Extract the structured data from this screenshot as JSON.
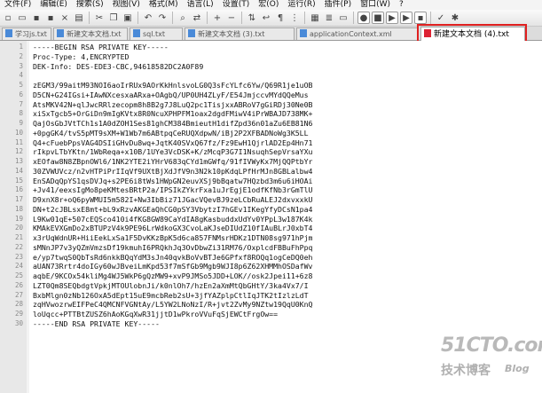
{
  "menu": [
    "文件(F)",
    "编辑(E)",
    "搜索(S)",
    "视图(V)",
    "格式(M)",
    "语言(L)",
    "设置(T)",
    "宏(O)",
    "运行(R)",
    "插件(P)",
    "窗口(W)",
    "?"
  ],
  "tabs": [
    {
      "label": "学习js.txt"
    },
    {
      "label": "新建文本文档.txt"
    },
    {
      "label": "sql.txt"
    },
    {
      "label": "新建文本文档 (3).txt"
    },
    {
      "label": "applicationContext.xml"
    },
    {
      "label": "新建文本文档 (4).txt",
      "active": true
    }
  ],
  "editor": {
    "lines": [
      {
        "n": "1",
        "text": "-----BEGIN RSA PRIVATE KEY-----"
      },
      {
        "n": "2",
        "text": "Proc-Type: 4,ENCRYPTED"
      },
      {
        "n": "3",
        "text": "DEK-Info: DES-EDE3-CBC,94618582DC2A0F89"
      },
      {
        "n": "4",
        "text": ""
      },
      {
        "n": "5",
        "text": "zEGM3/99aitM93NOI6aoIrRUx9AOrKkHnlsvoLG0Q3sFcYLfc6Yw/Q69R1je1uOB"
      },
      {
        "n": "6",
        "text": "D5CN+G24IGsi+IAwNXcesxaARxa+OAgbQ/UP0UH4ZLyF/E54JmjccvMYdQQeMus"
      },
      {
        "n": "7",
        "text": "AtsMKV42N+qlJwcRRlzecopm8h8B2g7J8LuQ2pc1TisjxxABRoV7gGiRDj30Ne0B"
      },
      {
        "n": "8",
        "text": "xiSxTgcb5+OrGiDn9mIgKVtx8R0NcuXPHPFM1oax2dgdFMiwV4iPrWBAJD738MK+"
      },
      {
        "n": "9",
        "text": "QajOsGbJVtTCh1s1A0dZOH1Ses81ghCM384BmieutH1difZpd36n01aZu6EB81N6"
      },
      {
        "n": "10",
        "text": "+0pgGK4/tvS5pMT9sXM+W1Wb7m6ABtpqCeRUQXdpwN/iBj2P2XFBADNoWg3K5LL"
      },
      {
        "n": "11",
        "text": "Q4+cFuebPpsVAG4DSIiGHvDu8wq+JqtK40SVxQ67fz/Fz9EwH1QjrlAD2Ep4Hn71"
      },
      {
        "n": "12",
        "text": "rIkpvLTbYKtn/1WbReqa+x10B/1UYe3VcDSK+K/zMcqP3G7I1NsuqhSepVrsaYXu"
      },
      {
        "n": "13",
        "text": "xEOfaw8N8ZBpnOWl6/1NK2YTE2iYHrV683qCYd1mGWfq/91fIVWyKx7MjQQPtbYr"
      },
      {
        "n": "14",
        "text": "30ZVWUVcz/n2vHTPiPrIIqVf9UXtBjXdJfV9n3N2k10pKdqLPfHrMJn8GBLalbw4"
      },
      {
        "n": "15",
        "text": "EnSADqQpYS1qsDVJq+s2PE6i8tWs1HWpGN2euvXSj9bBqatw7HQzbd3m6u6iHOAi"
      },
      {
        "n": "16",
        "text": "+Jv41/eexsIgMo8peKMtesBRtP2a/IPSIkZYkrFxa1uJrEgjE1odfKfNb3rGmTlU"
      },
      {
        "n": "17",
        "text": "D9xnX8r+oQ6pyWMUI5m582I+Nw3IbBiz71JGacVQevBJ9zeLCbRuALEJ2dxvxxkU"
      },
      {
        "n": "18",
        "text": "DN+t2cJBLsxE8mt+bL9xRzvAKGEaQhCG0pSY3VbytzI7hGEv1IKegYfyDCsN1pa4"
      },
      {
        "n": "19",
        "text": "L9Kw01qE+507cEQSco410i4fKG8GW89CaYdIA8gKasbuddxUdYv0YPpL3w187K4k"
      },
      {
        "n": "20",
        "text": "KMAkEVXGmDo2xBTUPzV4k9PE96LrWdkoGX3CvoLaKJseDIUdZ10fIAuBLrJ0xbT4"
      },
      {
        "n": "21",
        "text": "x3rUqWdnUR+HiiEekLxSa1F5DvKKzBpK5d6ca857FNMsrHDKz1DTN08sg971hPjm"
      },
      {
        "n": "22",
        "text": "sMNnJP7v3yQZmVmzsDf19kmuhI6PRQkhJq3OvDbwZi31RM76/OxplcdFBBuFhPpq"
      },
      {
        "n": "23",
        "text": "e/yp7twqS0QbTsRd6nkkBQqYdM3sJn40qvkBoVvBTJe6GPfxf8ROQq1ogCeDQ0eh"
      },
      {
        "n": "24",
        "text": "aUAN73Rrtr4doIGy60wJBveiLmKpd53f7mSfGb9Mgb9WJI8p6Z62XHMMhOSDafWv"
      },
      {
        "n": "25",
        "text": "aqbE/9KCOx54kliMg4WJ5WkP6gQzMW9+xvP9JMSo5JDD+LOK//osk2Jpei11+6z8"
      },
      {
        "n": "26",
        "text": "LZT0Qm8SEQbdgtVpkjMTOUlobnJi/k0nlOh7/hzEn2aXmMtQbGHtY/3ka4Vx7/I"
      },
      {
        "n": "27",
        "text": "BxbMlgn0zNb126OxA5dEpt15uE9mcbReb2sU+3jfYAZplpCtlIqJTK2tIzlzLdT"
      },
      {
        "n": "28",
        "text": "zqHVwozrwEIFPeC4QMCNFVGNtAy/L5YW2LNoNzI/R+jvt2ZvMy9NZtw19QqU0KnQ"
      },
      {
        "n": "29",
        "text": "loUqcc+PTTBtZUSZ6hAoKGqXwR31jjtD1wPkroVVuFqSjEWCtFrgOw=="
      },
      {
        "n": "30",
        "text": "-----END RSA PRIVATE KEY-----"
      }
    ]
  },
  "watermark": {
    "brand": "51CTO.com",
    "sub": "技术博客",
    "blog": "Blog"
  },
  "colors": {
    "active_tab_highlight": "#e02020",
    "editor_bg": "#ffffff",
    "gutter_bg": "#e8e8e8"
  }
}
